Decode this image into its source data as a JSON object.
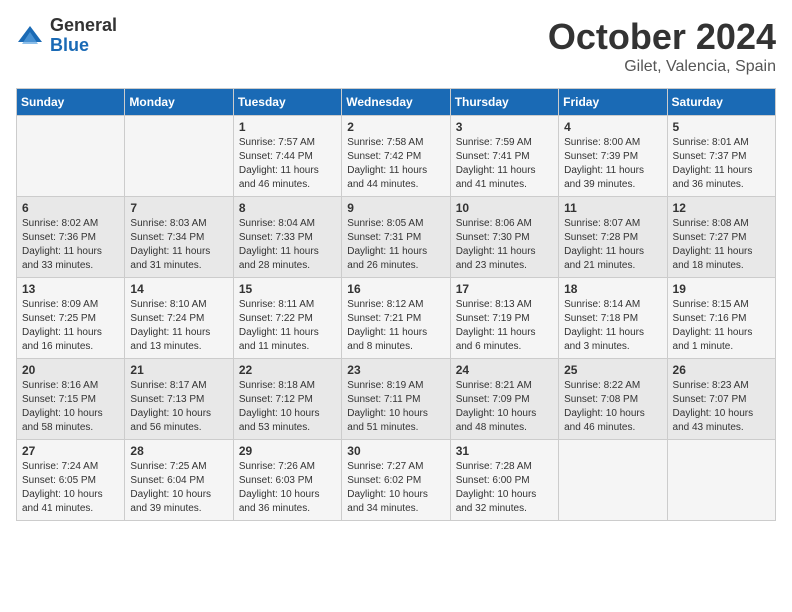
{
  "logo": {
    "general": "General",
    "blue": "Blue"
  },
  "title": {
    "month": "October 2024",
    "location": "Gilet, Valencia, Spain"
  },
  "days_header": [
    "Sunday",
    "Monday",
    "Tuesday",
    "Wednesday",
    "Thursday",
    "Friday",
    "Saturday"
  ],
  "weeks": [
    [
      {
        "day": "",
        "info": ""
      },
      {
        "day": "",
        "info": ""
      },
      {
        "day": "1",
        "info": "Sunrise: 7:57 AM\nSunset: 7:44 PM\nDaylight: 11 hours and 46 minutes."
      },
      {
        "day": "2",
        "info": "Sunrise: 7:58 AM\nSunset: 7:42 PM\nDaylight: 11 hours and 44 minutes."
      },
      {
        "day": "3",
        "info": "Sunrise: 7:59 AM\nSunset: 7:41 PM\nDaylight: 11 hours and 41 minutes."
      },
      {
        "day": "4",
        "info": "Sunrise: 8:00 AM\nSunset: 7:39 PM\nDaylight: 11 hours and 39 minutes."
      },
      {
        "day": "5",
        "info": "Sunrise: 8:01 AM\nSunset: 7:37 PM\nDaylight: 11 hours and 36 minutes."
      }
    ],
    [
      {
        "day": "6",
        "info": "Sunrise: 8:02 AM\nSunset: 7:36 PM\nDaylight: 11 hours and 33 minutes."
      },
      {
        "day": "7",
        "info": "Sunrise: 8:03 AM\nSunset: 7:34 PM\nDaylight: 11 hours and 31 minutes."
      },
      {
        "day": "8",
        "info": "Sunrise: 8:04 AM\nSunset: 7:33 PM\nDaylight: 11 hours and 28 minutes."
      },
      {
        "day": "9",
        "info": "Sunrise: 8:05 AM\nSunset: 7:31 PM\nDaylight: 11 hours and 26 minutes."
      },
      {
        "day": "10",
        "info": "Sunrise: 8:06 AM\nSunset: 7:30 PM\nDaylight: 11 hours and 23 minutes."
      },
      {
        "day": "11",
        "info": "Sunrise: 8:07 AM\nSunset: 7:28 PM\nDaylight: 11 hours and 21 minutes."
      },
      {
        "day": "12",
        "info": "Sunrise: 8:08 AM\nSunset: 7:27 PM\nDaylight: 11 hours and 18 minutes."
      }
    ],
    [
      {
        "day": "13",
        "info": "Sunrise: 8:09 AM\nSunset: 7:25 PM\nDaylight: 11 hours and 16 minutes."
      },
      {
        "day": "14",
        "info": "Sunrise: 8:10 AM\nSunset: 7:24 PM\nDaylight: 11 hours and 13 minutes."
      },
      {
        "day": "15",
        "info": "Sunrise: 8:11 AM\nSunset: 7:22 PM\nDaylight: 11 hours and 11 minutes."
      },
      {
        "day": "16",
        "info": "Sunrise: 8:12 AM\nSunset: 7:21 PM\nDaylight: 11 hours and 8 minutes."
      },
      {
        "day": "17",
        "info": "Sunrise: 8:13 AM\nSunset: 7:19 PM\nDaylight: 11 hours and 6 minutes."
      },
      {
        "day": "18",
        "info": "Sunrise: 8:14 AM\nSunset: 7:18 PM\nDaylight: 11 hours and 3 minutes."
      },
      {
        "day": "19",
        "info": "Sunrise: 8:15 AM\nSunset: 7:16 PM\nDaylight: 11 hours and 1 minute."
      }
    ],
    [
      {
        "day": "20",
        "info": "Sunrise: 8:16 AM\nSunset: 7:15 PM\nDaylight: 10 hours and 58 minutes."
      },
      {
        "day": "21",
        "info": "Sunrise: 8:17 AM\nSunset: 7:13 PM\nDaylight: 10 hours and 56 minutes."
      },
      {
        "day": "22",
        "info": "Sunrise: 8:18 AM\nSunset: 7:12 PM\nDaylight: 10 hours and 53 minutes."
      },
      {
        "day": "23",
        "info": "Sunrise: 8:19 AM\nSunset: 7:11 PM\nDaylight: 10 hours and 51 minutes."
      },
      {
        "day": "24",
        "info": "Sunrise: 8:21 AM\nSunset: 7:09 PM\nDaylight: 10 hours and 48 minutes."
      },
      {
        "day": "25",
        "info": "Sunrise: 8:22 AM\nSunset: 7:08 PM\nDaylight: 10 hours and 46 minutes."
      },
      {
        "day": "26",
        "info": "Sunrise: 8:23 AM\nSunset: 7:07 PM\nDaylight: 10 hours and 43 minutes."
      }
    ],
    [
      {
        "day": "27",
        "info": "Sunrise: 7:24 AM\nSunset: 6:05 PM\nDaylight: 10 hours and 41 minutes."
      },
      {
        "day": "28",
        "info": "Sunrise: 7:25 AM\nSunset: 6:04 PM\nDaylight: 10 hours and 39 minutes."
      },
      {
        "day": "29",
        "info": "Sunrise: 7:26 AM\nSunset: 6:03 PM\nDaylight: 10 hours and 36 minutes."
      },
      {
        "day": "30",
        "info": "Sunrise: 7:27 AM\nSunset: 6:02 PM\nDaylight: 10 hours and 34 minutes."
      },
      {
        "day": "31",
        "info": "Sunrise: 7:28 AM\nSunset: 6:00 PM\nDaylight: 10 hours and 32 minutes."
      },
      {
        "day": "",
        "info": ""
      },
      {
        "day": "",
        "info": ""
      }
    ]
  ]
}
